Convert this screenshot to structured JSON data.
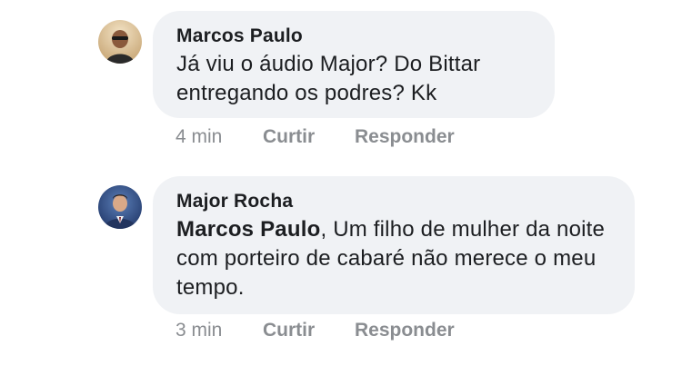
{
  "comments": [
    {
      "author": "Marcos Paulo",
      "text": "Já viu o áudio Major? Do Bittar entregando os podres? Kk",
      "time": "4 min",
      "like_label": "Curtir",
      "reply_label": "Responder"
    },
    {
      "author": "Major Rocha",
      "mention": "Marcos Paulo",
      "text": ", Um filho de mulher da noite com porteiro de cabaré não merece o meu tempo.",
      "time": "3 min",
      "like_label": "Curtir",
      "reply_label": "Responder"
    }
  ],
  "colors": {
    "bubble": "#f0f2f5",
    "text": "#1c1e21",
    "meta": "#8a8d91"
  }
}
